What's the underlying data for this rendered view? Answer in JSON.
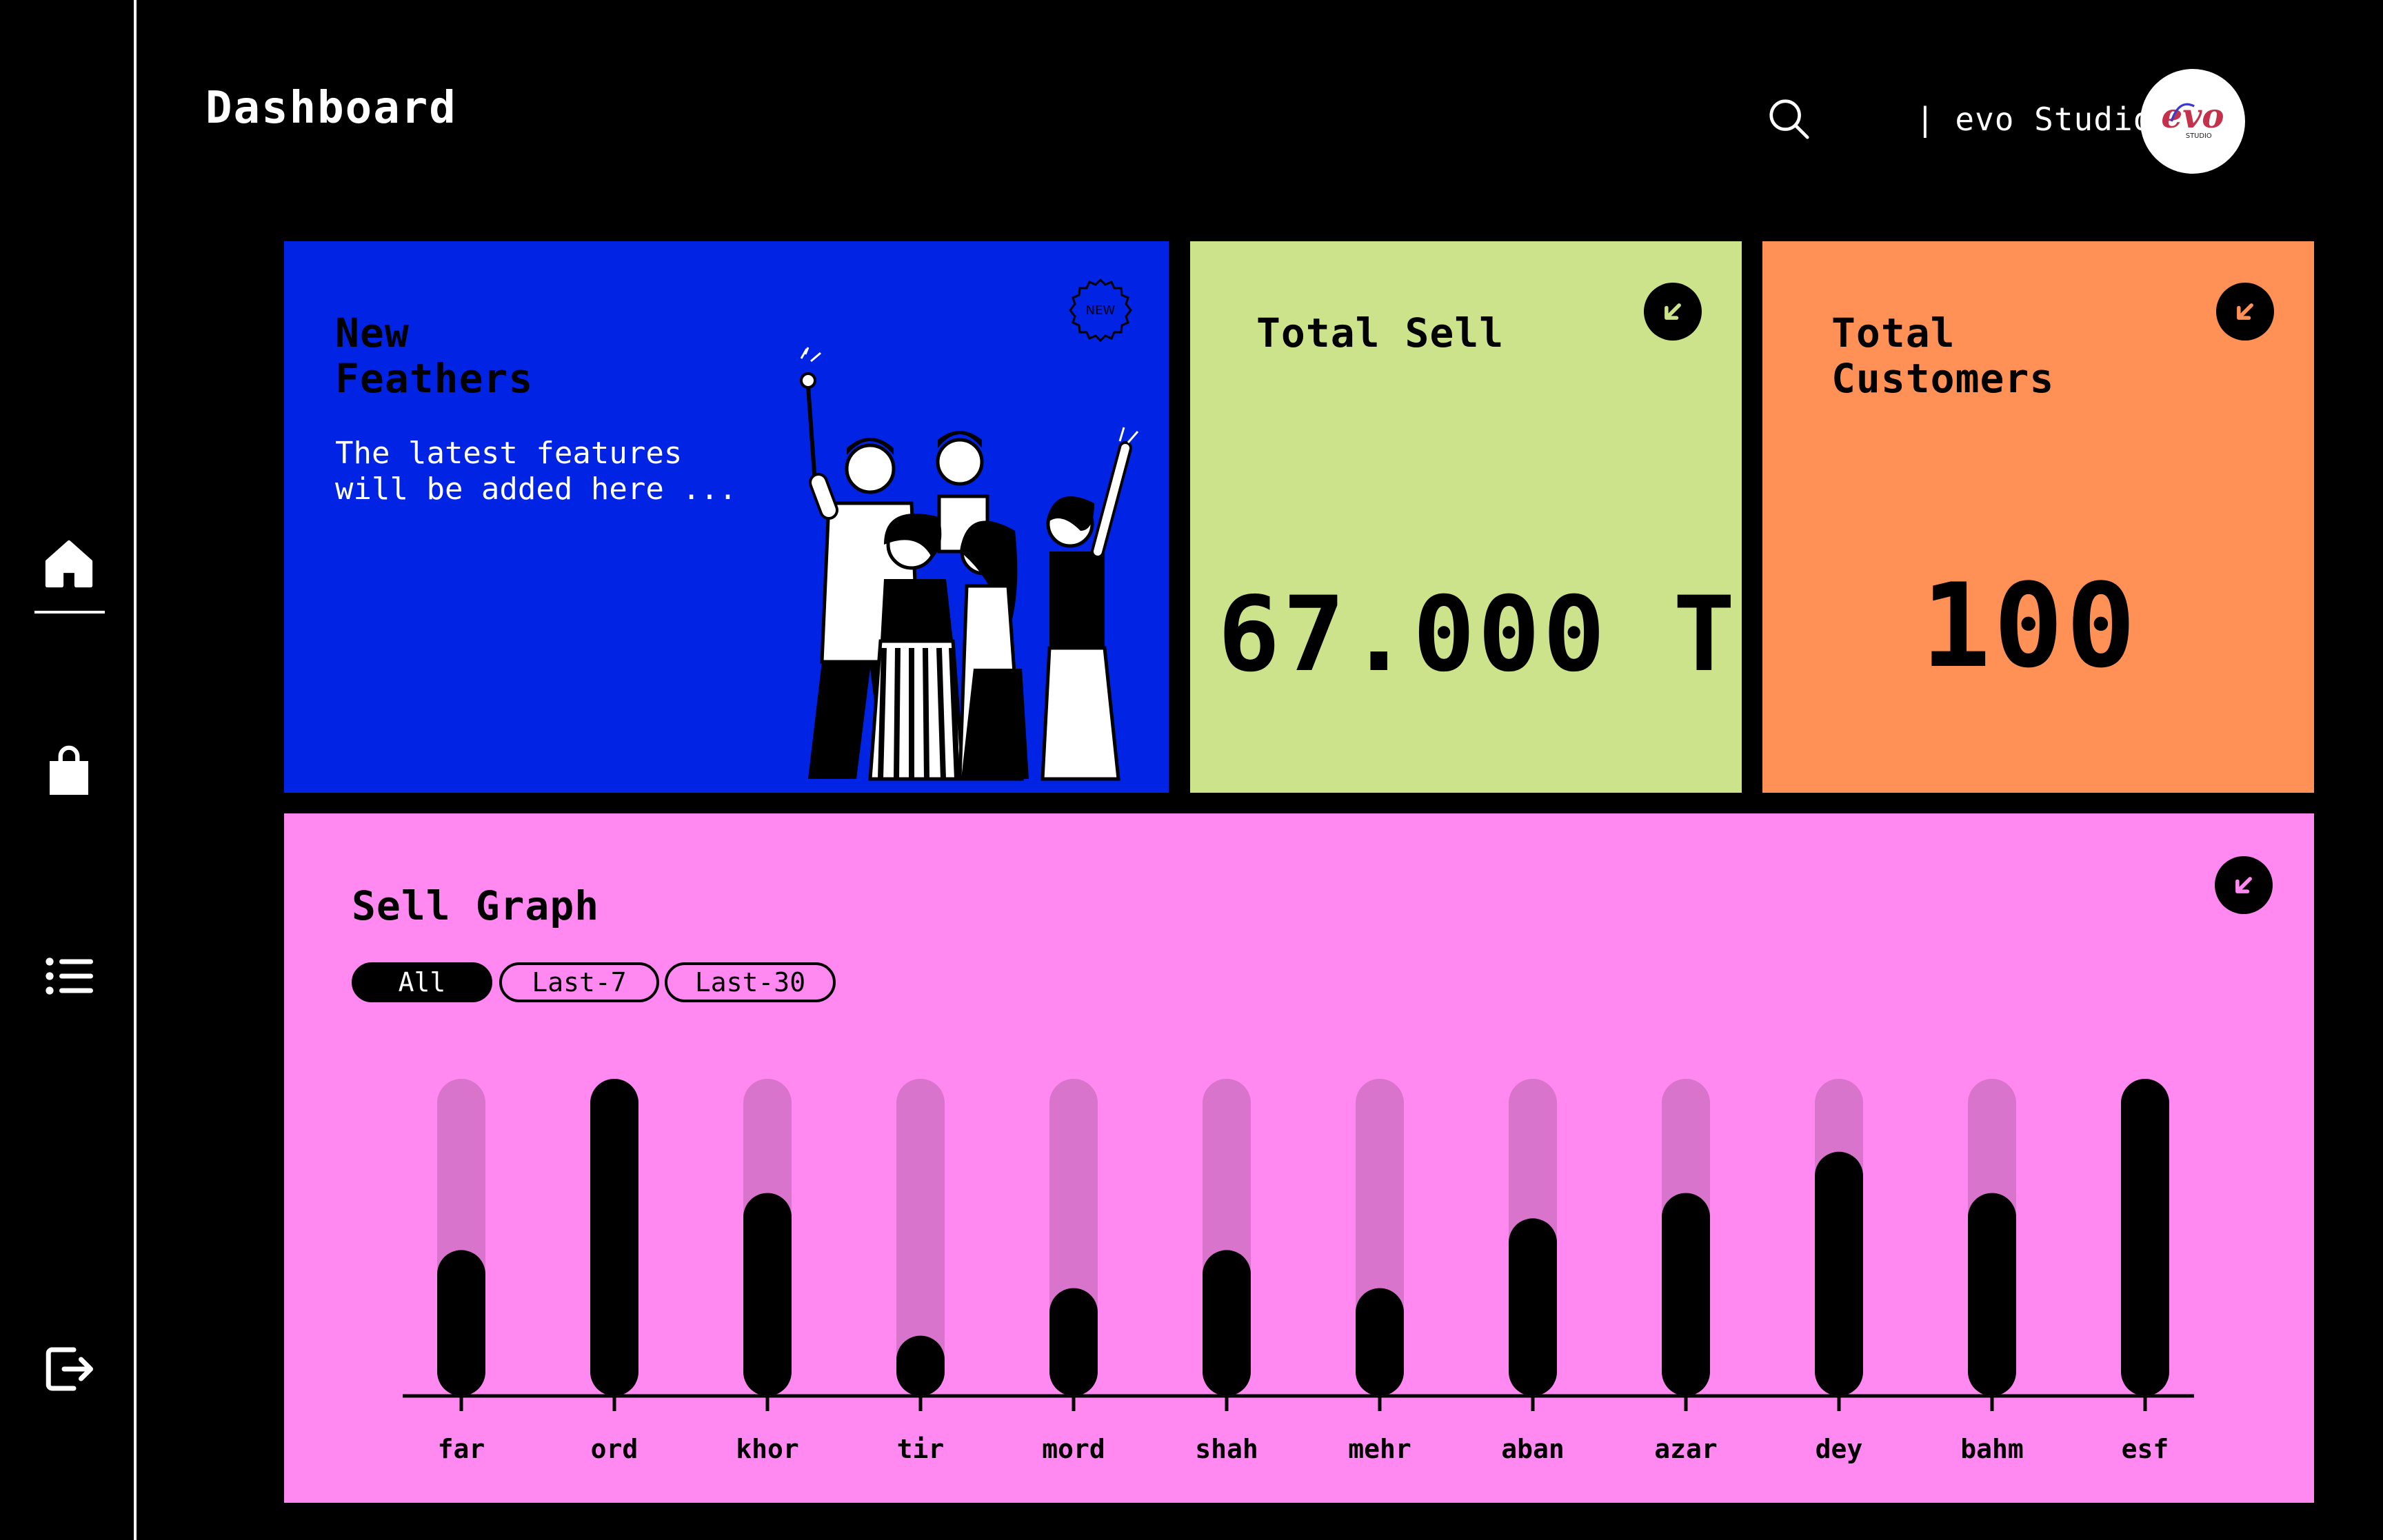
{
  "app": {
    "title": "Dashboard",
    "studio_name": "| evo Studio",
    "avatar_logo": "evo STUDIO"
  },
  "sidebar": {
    "items": [
      {
        "icon": "home-icon",
        "active": true
      },
      {
        "icon": "shopping-bag-icon",
        "active": false
      },
      {
        "icon": "list-icon",
        "active": false
      }
    ],
    "logout_icon": "logout-icon"
  },
  "cards": {
    "features": {
      "title": "New\nFeathers",
      "subtitle": "The latest features\nwill be added here ...",
      "badge": "NEW",
      "color": "#0023e4"
    },
    "total_sell": {
      "title": "Total Sell",
      "value": "67.000 T",
      "color": "#cce28b"
    },
    "total_customers": {
      "title": "Total\nCustomers",
      "value": "100",
      "color": "#ff9157"
    }
  },
  "sell_graph": {
    "title": "Sell Graph",
    "filters": [
      {
        "label": "All",
        "active": true
      },
      {
        "label": "Last-7",
        "active": false
      },
      {
        "label": "Last-30",
        "active": false
      }
    ],
    "color": "#ff88f1"
  },
  "chart_data": {
    "type": "bar",
    "title": "Sell Graph",
    "categories": [
      "far",
      "ord",
      "khor",
      "tir",
      "mord",
      "shah",
      "mehr",
      "aban",
      "azar",
      "dey",
      "bahm",
      "esf"
    ],
    "values": [
      0.46,
      1.0,
      0.64,
      0.19,
      0.34,
      0.46,
      0.34,
      0.56,
      0.64,
      0.77,
      0.64,
      1.0
    ],
    "ylim": [
      0,
      1
    ],
    "grid": false,
    "legend": "none"
  }
}
